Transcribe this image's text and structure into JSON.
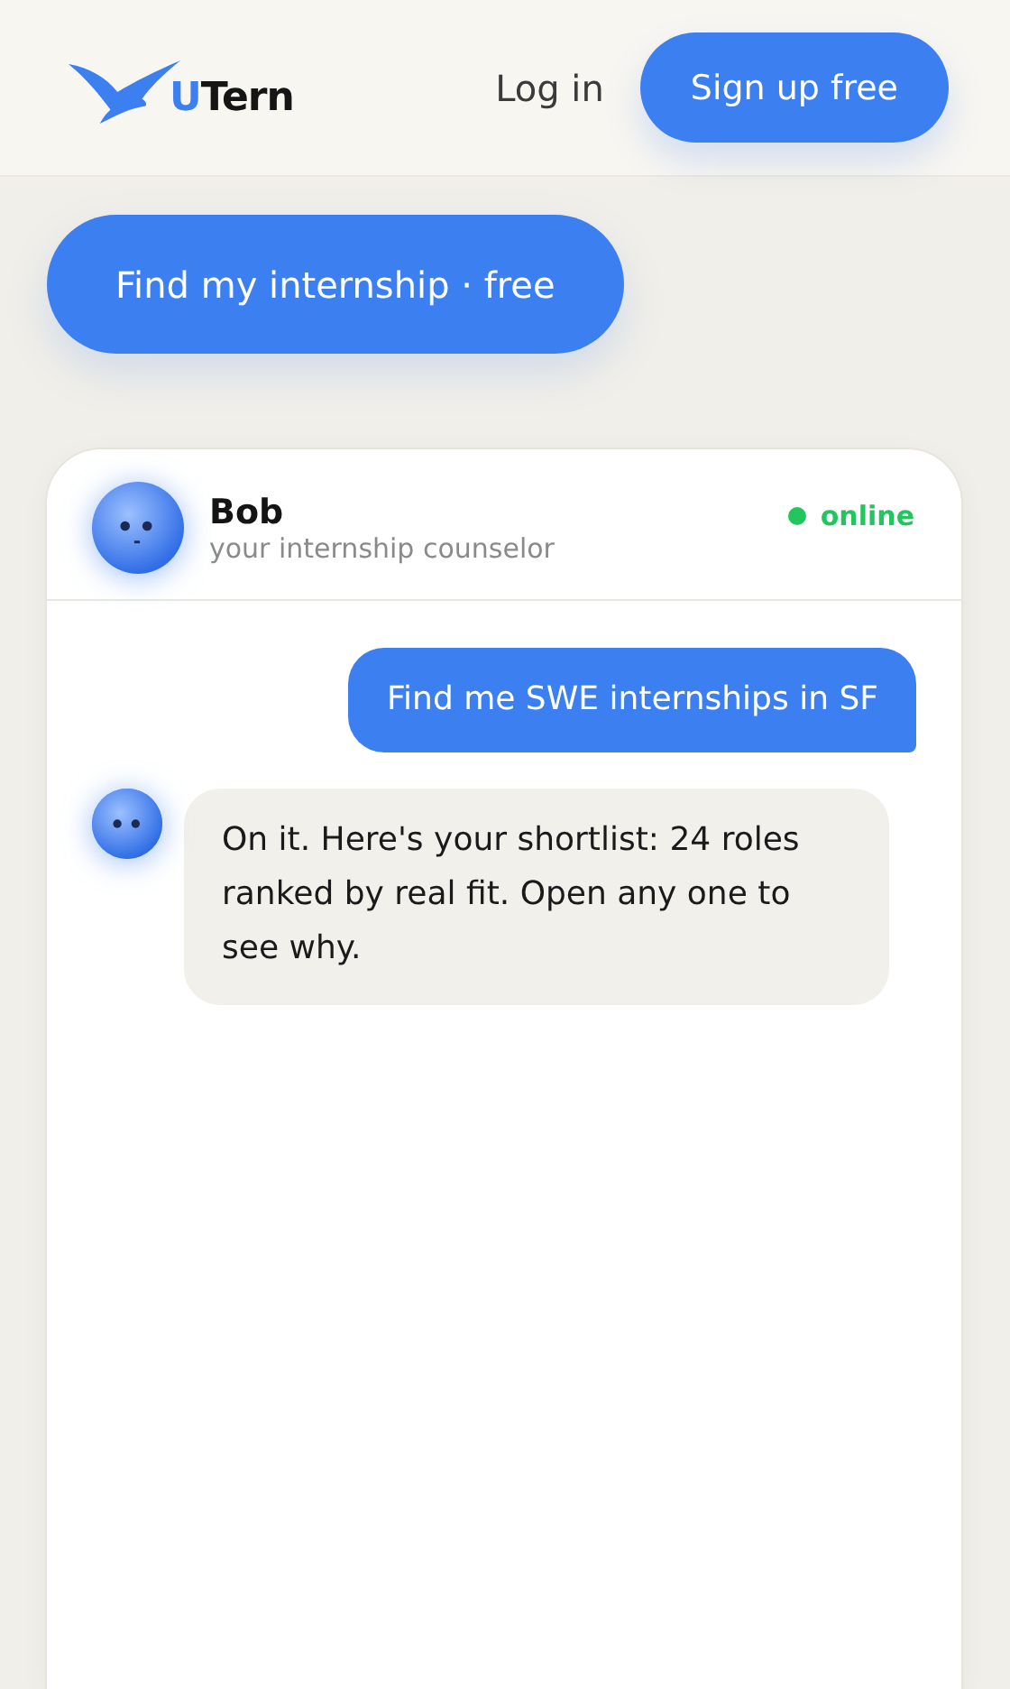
{
  "header": {
    "logo_accent": "U",
    "logo_rest": "Tern",
    "login": "Log in",
    "signup": "Sign up free"
  },
  "cta": "Find my internship · free",
  "chat": {
    "name": "Bob",
    "subtitle": "your internship counselor",
    "online": true,
    "status": "online",
    "messages": [
      {
        "kind": "user",
        "text": "Find me SWE internships in SF"
      },
      {
        "kind": "bot",
        "text": "On it. Here's your shortlist: 24 roles ranked by real fit. Open any one to see why."
      }
    ]
  }
}
